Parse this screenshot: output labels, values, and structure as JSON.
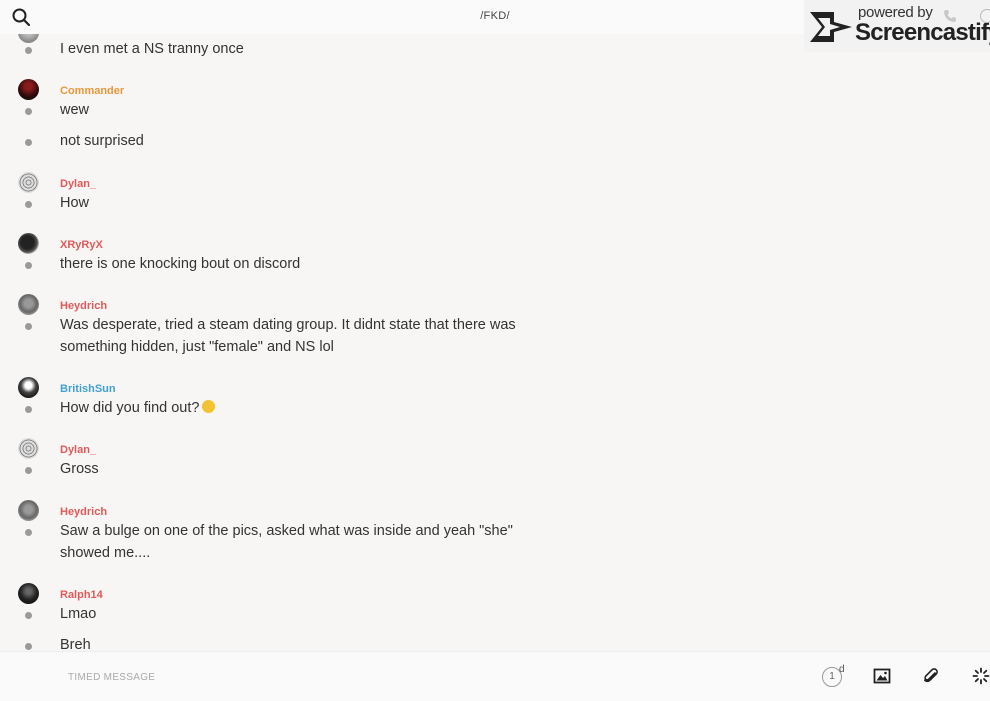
{
  "header": {
    "room_title": "/FKD/",
    "icons": [
      "search-icon",
      "phone-icon",
      "info-icon"
    ]
  },
  "watermark": {
    "powered_by": "powered by",
    "brand": "Screencastify"
  },
  "messages": [
    {
      "type": "continuation",
      "text": "I even met a NS tranny once"
    },
    {
      "type": "header",
      "username": "Commander",
      "color": "#e8973a",
      "text": "wew"
    },
    {
      "type": "continuation",
      "text": "not surprised"
    },
    {
      "type": "header",
      "username": "Dylan_",
      "color": "#e05a5a",
      "text": "How"
    },
    {
      "type": "header",
      "username": "XRyRyX",
      "color": "#e05a5a",
      "text": "there is one knocking bout on discord"
    },
    {
      "type": "header",
      "username": "Heydrich",
      "color": "#e05a5a",
      "text": "Was desperate, tried a steam dating group. It didnt state that there was something hidden, just \"female\" and NS lol"
    },
    {
      "type": "header",
      "username": "BritishSun",
      "color": "#3fa0d8",
      "text": "How did you find out?",
      "emoji": "slightly-smiling-emoji"
    },
    {
      "type": "header",
      "username": "Dylan_",
      "color": "#e05a5a",
      "text": "Gross"
    },
    {
      "type": "header",
      "username": "Heydrich",
      "color": "#e05a5a",
      "text": "Saw a bulge on one of the pics, asked what was inside and yeah \"she\" showed me...."
    },
    {
      "type": "header",
      "username": "Ralph14",
      "color": "#e05a5a",
      "text": "Lmao"
    },
    {
      "type": "continuation",
      "text": "Breh"
    }
  ],
  "composer": {
    "placeholder": "TIMED MESSAGE",
    "timer_value": "1",
    "timer_unit": "d",
    "icons": [
      "image-icon",
      "attachment-icon",
      "loading-spinner-icon"
    ]
  }
}
